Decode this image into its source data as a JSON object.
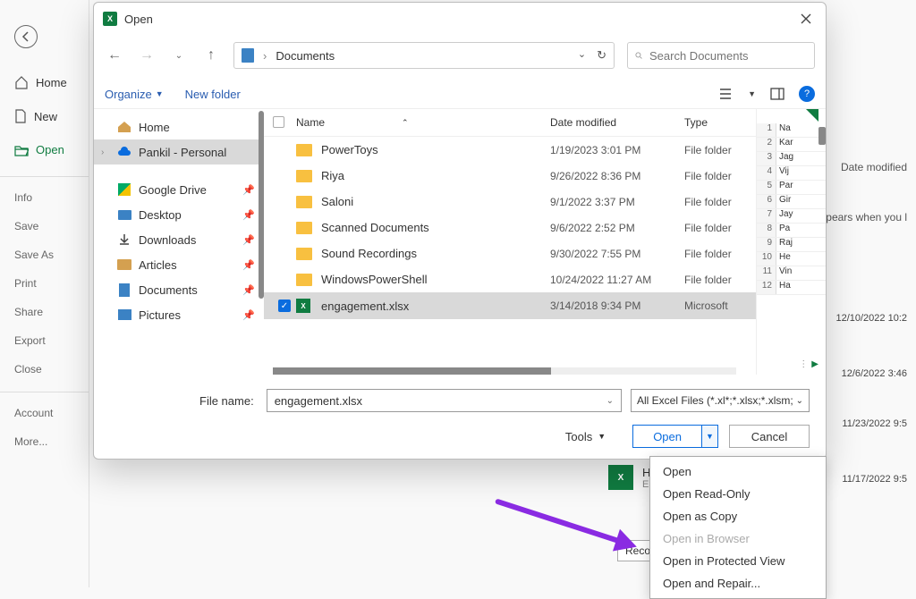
{
  "bg_sidebar": {
    "home": "Home",
    "new": "New",
    "open": "Open",
    "subitems": [
      "Info",
      "Save",
      "Save As",
      "Print",
      "Share",
      "Export",
      "Close"
    ],
    "account": "Account",
    "more": "More..."
  },
  "bg_headers": {
    "date_modified": "Date modified",
    "hint": "pears when you l"
  },
  "bg_rows": [
    "12/10/2022 10:2",
    "12/6/2022 3:46",
    "11/23/2022 9:5",
    "11/17/2022 9:5"
  ],
  "bg_recent": {
    "name": "HISHAB RT",
    "path": "E:"
  },
  "bg_recover": "Recover Unsaved W",
  "dialog": {
    "title": "Open",
    "path": "Documents",
    "search_placeholder": "Search Documents",
    "organize": "Organize",
    "new_folder": "New folder",
    "tree": [
      {
        "label": "Home",
        "icon": "home"
      },
      {
        "label": "Pankil - Personal",
        "icon": "cloud",
        "selected": true,
        "chev": true
      },
      {
        "label": "Google Drive",
        "icon": "gd",
        "pin": true
      },
      {
        "label": "Desktop",
        "icon": "desk",
        "pin": true
      },
      {
        "label": "Downloads",
        "icon": "dl",
        "pin": true
      },
      {
        "label": "Articles",
        "icon": "folder",
        "pin": true
      },
      {
        "label": "Documents",
        "icon": "doc",
        "pin": true
      },
      {
        "label": "Pictures",
        "icon": "pic",
        "pin": true
      }
    ],
    "columns": {
      "name": "Name",
      "date": "Date modified",
      "type": "Type"
    },
    "files": [
      {
        "name": "PowerToys",
        "date": "1/19/2023 3:01 PM",
        "type": "File folder",
        "kind": "folder"
      },
      {
        "name": "Riya",
        "date": "9/26/2022 8:36 PM",
        "type": "File folder",
        "kind": "folder"
      },
      {
        "name": "Saloni",
        "date": "9/1/2022 3:37 PM",
        "type": "File folder",
        "kind": "folder"
      },
      {
        "name": "Scanned Documents",
        "date": "9/6/2022 2:52 PM",
        "type": "File folder",
        "kind": "folder"
      },
      {
        "name": "Sound Recordings",
        "date": "9/30/2022 7:55 PM",
        "type": "File folder",
        "kind": "folder"
      },
      {
        "name": "WindowsPowerShell",
        "date": "10/24/2022 11:27 AM",
        "type": "File folder",
        "kind": "folder"
      },
      {
        "name": "engagement.xlsx",
        "date": "3/14/2018 9:34 PM",
        "type": "Microsoft",
        "kind": "xlsx",
        "selected": true
      }
    ],
    "preview_rows": [
      {
        "n": "1",
        "v": "Na"
      },
      {
        "n": "2",
        "v": "Kar"
      },
      {
        "n": "3",
        "v": "Jag"
      },
      {
        "n": "4",
        "v": "Vij"
      },
      {
        "n": "5",
        "v": "Par"
      },
      {
        "n": "6",
        "v": "Gir"
      },
      {
        "n": "7",
        "v": "Jay"
      },
      {
        "n": "8",
        "v": "Pa"
      },
      {
        "n": "9",
        "v": "Raj"
      },
      {
        "n": "10",
        "v": "He"
      },
      {
        "n": "11",
        "v": "Vin"
      },
      {
        "n": "12",
        "v": "Ha"
      }
    ],
    "file_name_label": "File name:",
    "file_name_value": "engagement.xlsx",
    "filter": "All Excel Files (*.xl*;*.xlsx;*.xlsm;",
    "tools": "Tools",
    "open_btn": "Open",
    "cancel_btn": "Cancel",
    "open_menu": [
      {
        "label": "Open"
      },
      {
        "label": "Open Read-Only"
      },
      {
        "label": "Open as Copy"
      },
      {
        "label": "Open in Browser",
        "disabled": true
      },
      {
        "label": "Open in Protected View"
      },
      {
        "label": "Open and Repair..."
      }
    ]
  }
}
